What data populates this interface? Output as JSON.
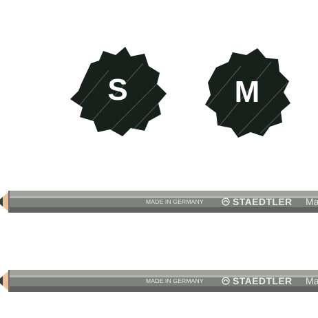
{
  "swatches": [
    {
      "letter": "S",
      "icon": "graphite-scribble-icon",
      "color": "#17211c"
    },
    {
      "letter": "M",
      "icon": "graphite-scribble-icon",
      "color": "#17211c"
    }
  ],
  "pencils": [
    {
      "made_in": "MADE IN GERMANY",
      "brand": "STAEDTLER",
      "model": "Ma",
      "logo": "mars-head-logo-icon",
      "body_color": "#7e817c"
    },
    {
      "made_in": "MADE IN GERMANY",
      "brand": "STAEDTLER",
      "model": "Ma",
      "logo": "mars-head-logo-icon",
      "body_color": "#7e817c"
    }
  ]
}
